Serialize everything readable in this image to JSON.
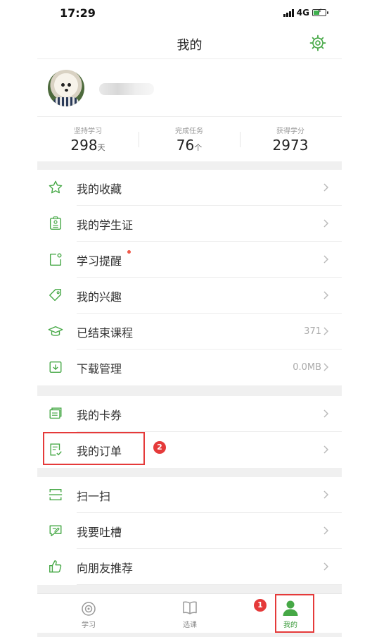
{
  "status_bar": {
    "time": "17:29",
    "network": "4G"
  },
  "header": {
    "title": "我的"
  },
  "stats": [
    {
      "label": "坚持学习",
      "value": "298",
      "unit": "天"
    },
    {
      "label": "完成任务",
      "value": "76",
      "unit": "个"
    },
    {
      "label": "获得学分",
      "value": "2973",
      "unit": ""
    }
  ],
  "menu_group_1": [
    {
      "label": "我的收藏",
      "icon": "star-icon",
      "meta": ""
    },
    {
      "label": "我的学生证",
      "icon": "student-card-icon",
      "meta": ""
    },
    {
      "label": "学习提醒",
      "icon": "reminder-icon",
      "meta": ""
    },
    {
      "label": "我的兴趣",
      "icon": "tag-icon",
      "meta": ""
    },
    {
      "label": "已结束课程",
      "icon": "graduation-cap-icon",
      "meta": "371"
    },
    {
      "label": "下载管理",
      "icon": "download-icon",
      "meta": "0.0MB"
    }
  ],
  "menu_group_2": [
    {
      "label": "我的卡券",
      "icon": "coupon-icon"
    },
    {
      "label": "我的订单",
      "icon": "order-icon"
    }
  ],
  "menu_group_3": [
    {
      "label": "扫一扫",
      "icon": "scan-icon"
    },
    {
      "label": "我要吐槽",
      "icon": "feedback-icon"
    },
    {
      "label": "向朋友推荐",
      "icon": "thumbs-up-icon"
    }
  ],
  "tabbar": [
    {
      "label": "学习",
      "icon": "study-icon",
      "active": false
    },
    {
      "label": "选课",
      "icon": "book-icon",
      "active": false
    },
    {
      "label": "我的",
      "icon": "person-icon",
      "active": true
    }
  ],
  "annotations": {
    "badge_1": "1",
    "badge_2": "2"
  },
  "colors": {
    "accent": "#46a846",
    "highlight": "#e53a3a"
  }
}
